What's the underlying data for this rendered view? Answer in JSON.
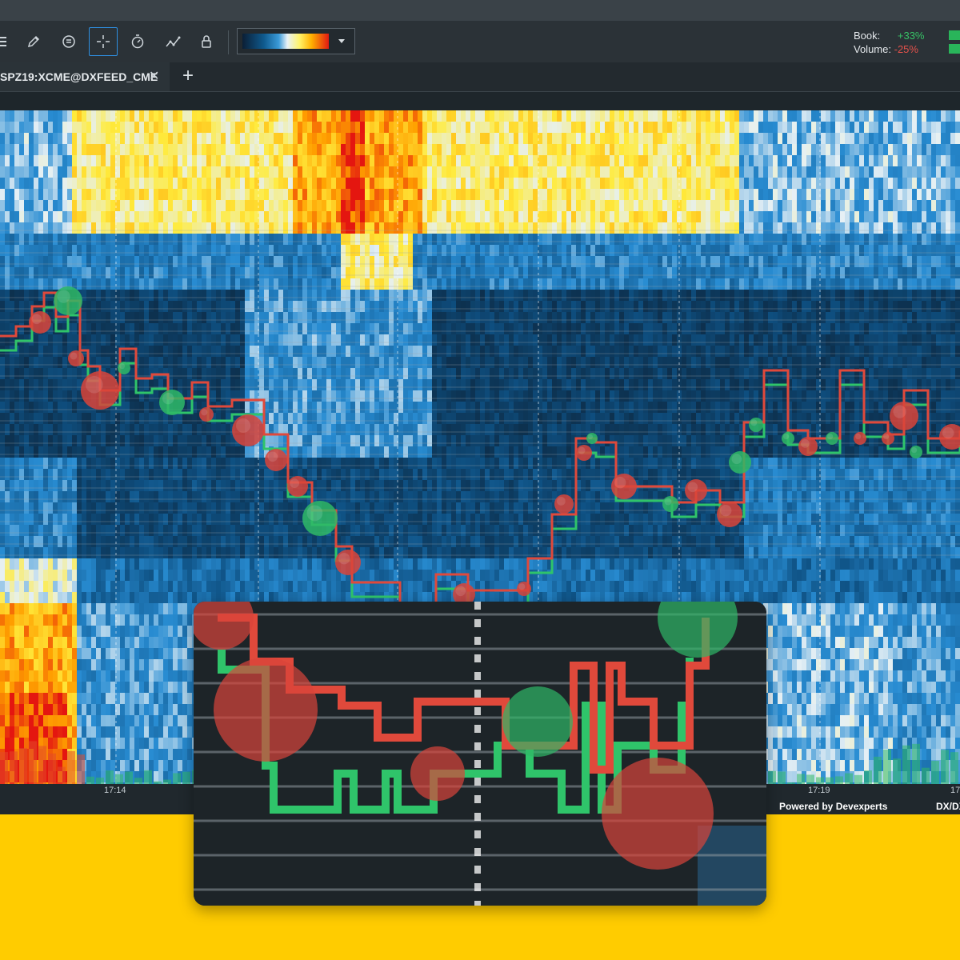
{
  "toolbar": {
    "tools": [
      {
        "name": "pencil-icon",
        "active": false
      },
      {
        "name": "comment-icon",
        "active": false
      },
      {
        "name": "crosshair-icon",
        "active": true
      },
      {
        "name": "stopwatch-icon",
        "active": false
      },
      {
        "name": "indicator-icon",
        "active": false
      },
      {
        "name": "lock-icon",
        "active": false
      }
    ],
    "palette_selector": "heatmap-palette-dropdown"
  },
  "stats": {
    "book_label": "Book:",
    "book_value": "+33%",
    "volume_label": "Volume:",
    "volume_value": "-25%"
  },
  "tabs": [
    {
      "label": "SPZ19:XCME@DXFEED_CME",
      "close": "✕"
    }
  ],
  "add_tab": "+",
  "axis": {
    "tick_left": "17:14",
    "tick_right": "17:19",
    "tick_far_right": "17"
  },
  "footer": {
    "powered": "Powered by Devexperts",
    "brand": "DX/DX"
  },
  "colors": {
    "bid_line": "#2fc46a",
    "ask_line": "#e0493b",
    "heat_low": "#0c1e30",
    "heat_mid": "#1f7fc0",
    "heat_high": "#ffe21a",
    "heat_max": "#e5170f",
    "page_background": "#ffcc00"
  }
}
